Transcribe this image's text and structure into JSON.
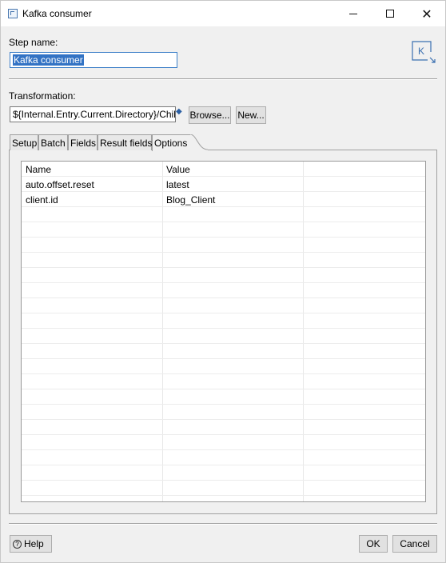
{
  "window": {
    "title": "Kafka consumer",
    "minimize_label": "",
    "maximize_label": "",
    "close_label": "✕"
  },
  "step": {
    "label": "Step name:",
    "value": "Kafka consumer",
    "logo_letter": "K"
  },
  "transformation": {
    "label": "Transformation:",
    "value": "${Internal.Entry.Current.Directory}/Chil",
    "variable_icon": "◆",
    "browse_label": "Browse...",
    "new_label": "New..."
  },
  "tabs": [
    {
      "label": "Setup"
    },
    {
      "label": "Batch"
    },
    {
      "label": "Fields"
    },
    {
      "label": "Result fields"
    },
    {
      "label": "Options",
      "active": true
    }
  ],
  "options_table": {
    "headers": [
      "Name",
      "Value"
    ],
    "rows": [
      [
        "auto.offset.reset",
        "latest"
      ],
      [
        "client.id",
        "Blog_Client"
      ]
    ]
  },
  "footer": {
    "help_label": "Help",
    "help_icon": "?",
    "ok_label": "OK",
    "cancel_label": "Cancel"
  }
}
